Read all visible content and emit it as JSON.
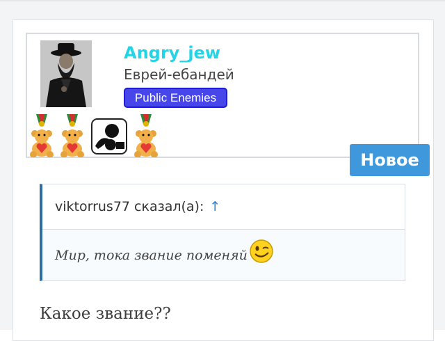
{
  "user": {
    "username": "Angry_jew",
    "title": "Еврей-ебандей",
    "group": "Public Enemies",
    "avatar_icon": "man-with-hat-avatar",
    "awards": [
      "teddy-bear-medal-icon",
      "teddy-bear-medal-icon",
      "emoticon-award-icon",
      "teddy-bear-medal-icon"
    ],
    "colors": {
      "username": "#22d4e6",
      "group_bg": "#4646ea"
    }
  },
  "post": {
    "new_badge": "Новое",
    "quote": {
      "author_line": "viktorrus77 сказал(а):",
      "jump_arrow": "↑",
      "text": "Мир, тока звание поменяй",
      "smiley_icon": "wink-smiley-icon"
    },
    "reply": "Какое звание??"
  }
}
